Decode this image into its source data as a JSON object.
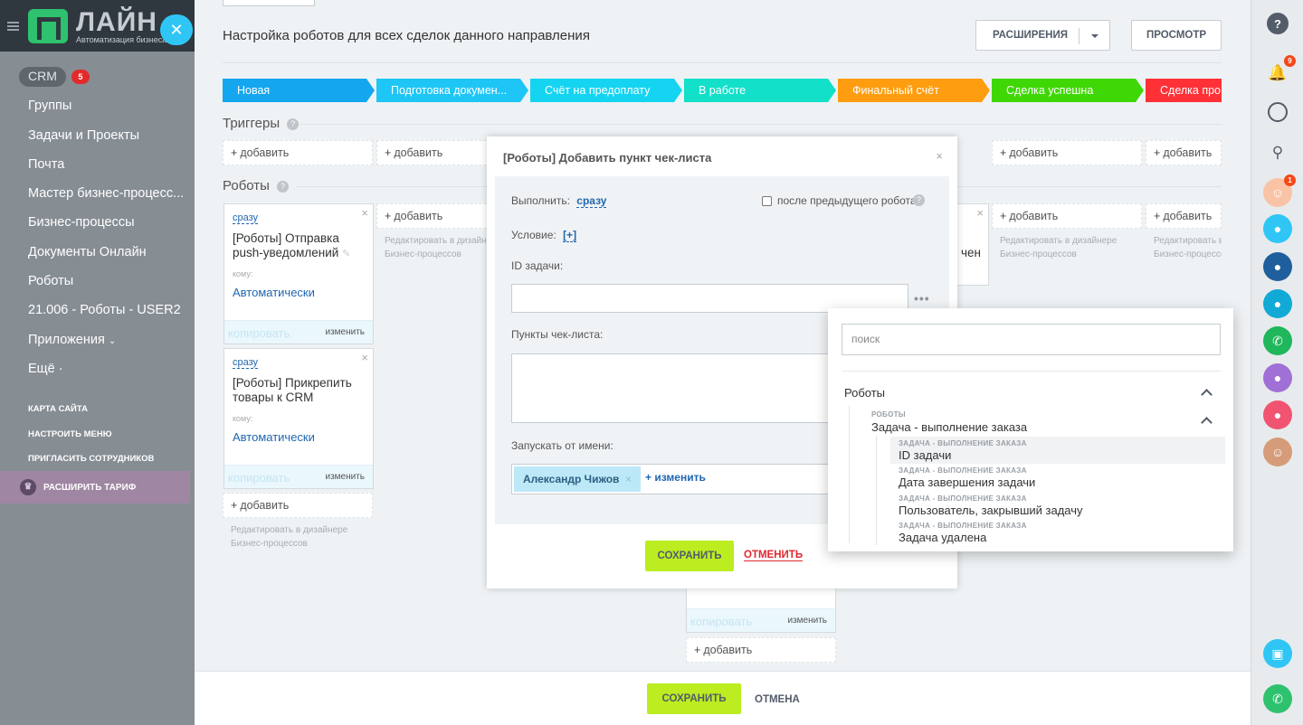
{
  "sidebar": {
    "logo_name": "ЛАЙН",
    "logo_sub": "Автоматизация бизнеса",
    "crm_label": "CRM",
    "crm_count": "5",
    "items": [
      "Группы",
      "Задачи и Проекты",
      "Почта",
      "Мастер бизнес-процесс...",
      "Бизнес-процессы",
      "Документы Онлайн",
      "Роботы",
      "21.006 - Роботы - USER2",
      "Приложения",
      "Ещё"
    ],
    "small": [
      "КАРТА САЙТА",
      "НАСТРОИТЬ МЕНЮ",
      "ПРИГЛАСИТЬ СОТРУДНИКОВ"
    ],
    "upgrade": "РАСШИРИТЬ ТАРИФ"
  },
  "header": {
    "title": "Настройка роботов для всех сделок данного направления",
    "extensions": "РАСШИРЕНИЯ",
    "preview": "ПРОСМОТР"
  },
  "stages": [
    {
      "label": "Новая",
      "color": "#14a7f0"
    },
    {
      "label": "Подготовка докумен...",
      "color": "#1ec6f6"
    },
    {
      "label": "Счёт на предоплату",
      "color": "#14d4f2"
    },
    {
      "label": "В работе",
      "color": "#12e0c8"
    },
    {
      "label": "Финальный счёт",
      "color": "#fe9d0f"
    },
    {
      "label": "Сделка успешна",
      "color": "#3fd706"
    },
    {
      "label": "Сделка про",
      "color": "#ff3137"
    }
  ],
  "triggers": {
    "label": "Триггеры",
    "add": "добавить"
  },
  "robots": {
    "label": "Роботы",
    "add": "добавить",
    "edit_hint_1": "Редактировать в дизайнере",
    "edit_hint_2": "Бизнес-процессов",
    "cards": [
      {
        "when": "сразу",
        "title": "[Роботы] Отправка push-уведомлений",
        "who": "кому:",
        "value": "Автоматически",
        "copy": "копировать",
        "change": "изменить"
      },
      {
        "when": "сразу",
        "title": "[Роботы] Прикрепить товары к CRM",
        "who": "кому:",
        "value": "Автоматически",
        "copy": "копировать",
        "change": "изменить"
      }
    ],
    "partial_text": "чен",
    "partial_copy": "копировать",
    "partial_change": "изменить"
  },
  "footer": {
    "save": "СОХРАНИТЬ",
    "cancel": "ОТМЕНА"
  },
  "dialog": {
    "title": "[Роботы] Добавить пункт чек-листа",
    "run_label": "Выполнить:",
    "run_value": "сразу",
    "after_prev": "после предыдущего робота",
    "condition_label": "Условие:",
    "condition_value": "[+]",
    "task_id_label": "ID задачи:",
    "checklist_label": "Пункты чек-листа:",
    "run_as_label": "Запускать от имени:",
    "user": "Александр Чижов",
    "change": "изменить",
    "save": "СОХРАНИТЬ",
    "cancel": "ОТМЕНИТЬ"
  },
  "dropdown": {
    "search_placeholder": "поиск",
    "group": "Роботы",
    "sub_caption": "РОБОТЫ",
    "sub_label": "Задача - выполнение заказа",
    "items": [
      {
        "caption": "ЗАДАЧА - ВЫПОЛНЕНИЕ ЗАКАЗА",
        "label": "ID задачи"
      },
      {
        "caption": "ЗАДАЧА - ВЫПОЛНЕНИЕ ЗАКАЗА",
        "label": "Дата завершения задачи"
      },
      {
        "caption": "ЗАДАЧА - ВЫПОЛНЕНИЕ ЗАКАЗА",
        "label": "Пользователь, закрывший задачу"
      },
      {
        "caption": "ЗАДАЧА - ВЫПОЛНЕНИЕ ЗАКАЗА",
        "label": "Задача удалена"
      }
    ]
  },
  "rightbar": {
    "notifications": "9",
    "chat": "1"
  }
}
